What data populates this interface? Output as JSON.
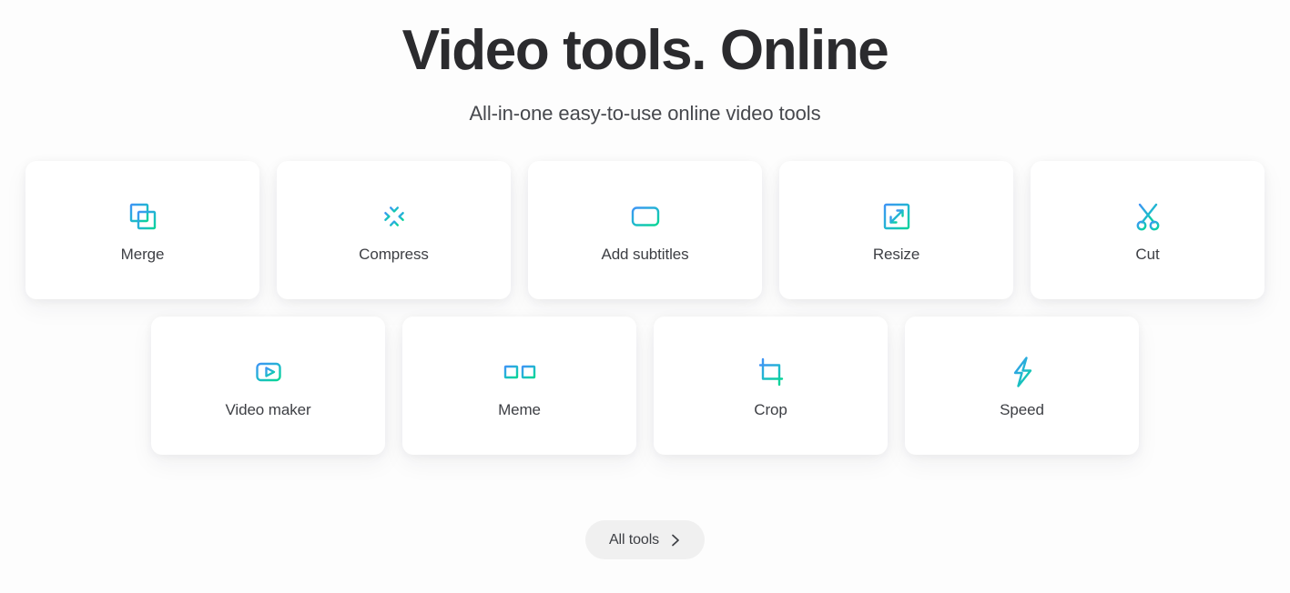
{
  "hero": {
    "title": "Video tools. Online",
    "subtitle": "All-in-one easy-to-use online video tools"
  },
  "colors": {
    "gradient_start": "#3f95f5",
    "gradient_end": "#0ad39a",
    "background": "#fdfdfd",
    "card_background": "#ffffff",
    "title_text": "#2b2b2e",
    "label_text": "#3d3f44",
    "pill_background": "#f0f0f0"
  },
  "tools": {
    "rows": [
      [
        {
          "label": "Merge",
          "icon": "merge-icon"
        },
        {
          "label": "Compress",
          "icon": "compress-icon"
        },
        {
          "label": "Add subtitles",
          "icon": "subtitles-icon"
        },
        {
          "label": "Resize",
          "icon": "resize-icon"
        },
        {
          "label": "Cut",
          "icon": "scissors-icon"
        }
      ],
      [
        {
          "label": "Video maker",
          "icon": "play-box-icon"
        },
        {
          "label": "Meme",
          "icon": "meme-frames-icon"
        },
        {
          "label": "Crop",
          "icon": "crop-icon"
        },
        {
          "label": "Speed",
          "icon": "lightning-bolt-icon"
        }
      ]
    ]
  },
  "footer": {
    "all_tools_label": "All tools",
    "all_tools_icon": "chevron-right-icon"
  }
}
